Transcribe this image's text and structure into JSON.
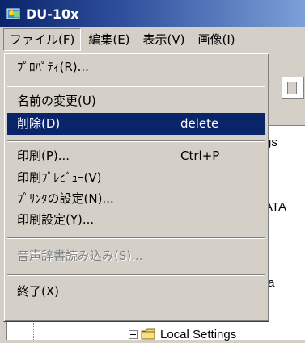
{
  "window": {
    "title": "DU-10x"
  },
  "menubar": [
    {
      "label": "ファイル(F)"
    },
    {
      "label": "編集(E)"
    },
    {
      "label": "表示(V)"
    },
    {
      "label": "画像(I)"
    }
  ],
  "file_menu": {
    "items": [
      {
        "label": "ﾌﾟﾛﾊﾟﾃｨ(R)...",
        "shortcut": ""
      },
      {
        "label": "名前の変更(U)",
        "shortcut": ""
      },
      {
        "label": "削除(D)",
        "shortcut": "delete",
        "selected": true
      },
      {
        "label": "印刷(P)...",
        "shortcut": "Ctrl+P"
      },
      {
        "label": "印刷ﾌﾟﾚﾋﾞｭｰ(V)",
        "shortcut": ""
      },
      {
        "label": "ﾌﾟﾘﾝﾀの設定(N)...",
        "shortcut": ""
      },
      {
        "label": "印刷設定(Y)...",
        "shortcut": ""
      },
      {
        "label": "音声辞書読み込み(S)...",
        "shortcut": "",
        "disabled": true
      },
      {
        "label": "終了(X)",
        "shortcut": ""
      }
    ]
  },
  "background_peek": {
    "line1": "gs",
    "line2": "ATA",
    "line3": "ta"
  },
  "tree": {
    "visible_item": "Local Settings"
  },
  "colors": {
    "selection": "#0a246a",
    "titlebar_start": "#0a246a",
    "titlebar_end": "#7ca0d8",
    "face": "#d4d0c8",
    "disabled_text": "#808080"
  },
  "icons": {
    "app": "app-icon",
    "folder": "folder-icon",
    "expand": "plus-expander-icon"
  }
}
